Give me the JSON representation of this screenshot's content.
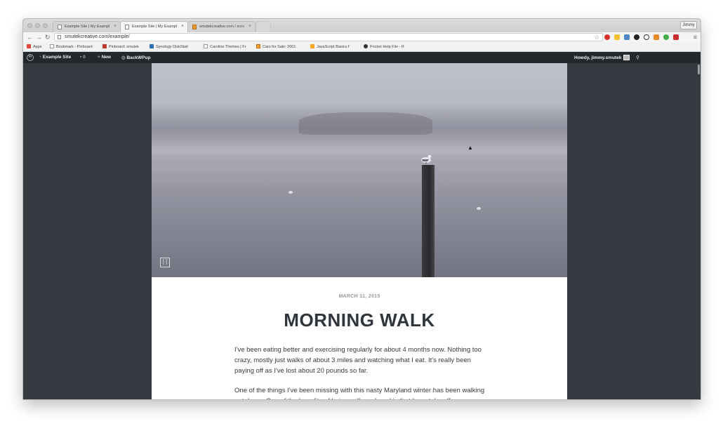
{
  "browser": {
    "tabs": [
      {
        "title": "Example Site | My Exampl",
        "active": false
      },
      {
        "title": "Example Site | My Exampl",
        "active": true
      },
      {
        "title": "smutekcreative.com / scro",
        "active": false
      }
    ],
    "profile": "Jimmy",
    "url": "smutekcreative.com/example/",
    "bookmarks": [
      "Apps",
      "Bookmark - Pinboard",
      "Pinboard: smutek",
      "Synology DiskStati",
      "Caroline Themes | Fr",
      "Cars for Sale: 2001",
      "JavaScript Basics f",
      "Pocket Help File - R"
    ]
  },
  "adminbar": {
    "site_name": "Example Site",
    "comments_count": "0",
    "new_label": "New",
    "plugin_label": "BackWPup",
    "howdy": "Howdy, jimmy.smutek"
  },
  "post": {
    "date": "MARCH 11, 2015",
    "title": "MORNING WALK",
    "paragraph1": "I've been eating better and exercising regularly for about 4 months now. Nothing too crazy, mostly just walks of about 3 miles and watching what I eat. It's really been paying off as I've lost about 20 pounds so far.",
    "paragraph2": "One of the things I've been missing with this nasty Maryland winter has been walking out doors. One of the benefits of being self employed is that I can take off"
  },
  "colors": {
    "adminbar_bg": "#23282d",
    "page_bg": "#343a40",
    "title_color": "#2f353a"
  }
}
